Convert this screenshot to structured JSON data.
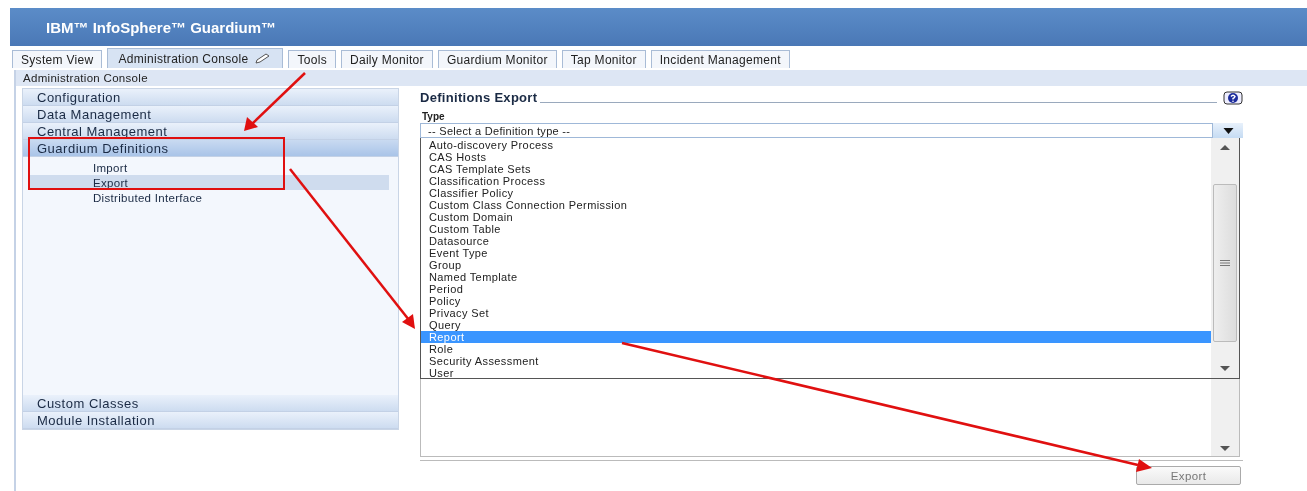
{
  "header": {
    "product": "IBM™ InfoSphere™ Guardium™"
  },
  "tabs": [
    {
      "label": "System View",
      "selected": false,
      "editable": false
    },
    {
      "label": "Administration Console",
      "selected": true,
      "editable": true
    },
    {
      "label": "Tools",
      "selected": false,
      "editable": false
    },
    {
      "label": "Daily Monitor",
      "selected": false,
      "editable": false
    },
    {
      "label": "Guardium Monitor",
      "selected": false,
      "editable": false
    },
    {
      "label": "Tap Monitor",
      "selected": false,
      "editable": false
    },
    {
      "label": "Incident Management",
      "selected": false,
      "editable": false
    }
  ],
  "breadcrumb": "Administration Console",
  "sidebar": {
    "sections": [
      {
        "label": "Configuration",
        "expanded": false
      },
      {
        "label": "Data Management",
        "expanded": false
      },
      {
        "label": "Central Management",
        "expanded": false
      },
      {
        "label": "Guardium Definitions",
        "expanded": true,
        "children": [
          {
            "label": "Import",
            "selected": false
          },
          {
            "label": "Export",
            "selected": true
          },
          {
            "label": "Distributed Interface",
            "selected": false
          }
        ]
      },
      {
        "label": "Custom Classes",
        "expanded": false
      },
      {
        "label": "Module Installation",
        "expanded": false
      }
    ]
  },
  "panel": {
    "title": "Definitions Export",
    "field_label": "Type",
    "select_value": "-- Select a Definition type --",
    "options": [
      {
        "label": "Auto-discovery Process",
        "selected": false
      },
      {
        "label": "CAS Hosts",
        "selected": false
      },
      {
        "label": "CAS Template Sets",
        "selected": false
      },
      {
        "label": "Classification Process",
        "selected": false
      },
      {
        "label": "Classifier Policy",
        "selected": false
      },
      {
        "label": "Custom Class Connection Permission",
        "selected": false
      },
      {
        "label": "Custom Domain",
        "selected": false
      },
      {
        "label": "Custom Table",
        "selected": false
      },
      {
        "label": "Datasource",
        "selected": false
      },
      {
        "label": "Event Type",
        "selected": false
      },
      {
        "label": "Group",
        "selected": false
      },
      {
        "label": "Named Template",
        "selected": false
      },
      {
        "label": "Period",
        "selected": false
      },
      {
        "label": "Policy",
        "selected": false
      },
      {
        "label": "Privacy Set",
        "selected": false
      },
      {
        "label": "Query",
        "selected": false
      },
      {
        "label": "Report",
        "selected": true
      },
      {
        "label": "Role",
        "selected": false
      },
      {
        "label": "Security Assessment",
        "selected": false
      },
      {
        "label": "User",
        "selected": false
      }
    ],
    "button": "Export"
  }
}
